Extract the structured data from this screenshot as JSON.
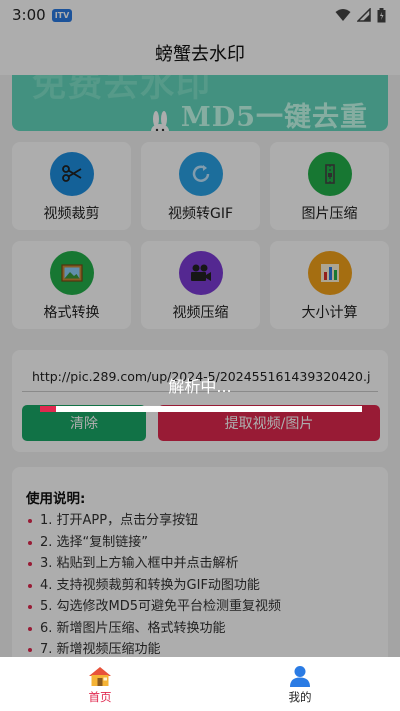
{
  "status_bar": {
    "time": "3:00",
    "badge": "ITV",
    "icons": [
      "wifi-icon",
      "cell-signal-icon",
      "battery-icon"
    ]
  },
  "header": {
    "title": "螃蟹去水印"
  },
  "banner": {
    "top_text": "免费去水印",
    "main_text": "MD5一键去重"
  },
  "tools": [
    {
      "label": "视频裁剪",
      "icon": "scissors-icon",
      "color": "#1e8fe0"
    },
    {
      "label": "视频转GIF",
      "icon": "refresh-icon",
      "color": "#2aa2e6"
    },
    {
      "label": "图片压缩",
      "icon": "compress-icon",
      "color": "#23b04b"
    },
    {
      "label": "格式转换",
      "icon": "picture-icon",
      "color": "#23b04b"
    },
    {
      "label": "视频压缩",
      "icon": "movie-camera-icon",
      "color": "#7c3bd6"
    },
    {
      "label": "大小计算",
      "icon": "bar-chart-icon",
      "color": "#f3a21a"
    }
  ],
  "url_input": {
    "value": "http://pic.289.com/up/2024-5/202455161439320420.j"
  },
  "buttons": {
    "clear": "清除",
    "extract": "提取视频/图片"
  },
  "instructions": {
    "title": "使用说明:",
    "items": [
      "1. 打开APP，点击分享按钮",
      "2. 选择“复制链接”",
      "3. 粘贴到上方输入框中并点击解析",
      "4. 支持视频裁剪和转换为GIF动图功能",
      "5. 勾选修改MD5可避免平台检测重复视频",
      "6. 新增图片压缩、格式转换功能",
      "7. 新增视频压缩功能"
    ]
  },
  "loading": {
    "text": "解析中...",
    "progress": 0.05
  },
  "tabbar": {
    "home": "首页",
    "mine": "我的"
  },
  "colors": {
    "accent": "#e0294f",
    "green": "#1aa868"
  }
}
